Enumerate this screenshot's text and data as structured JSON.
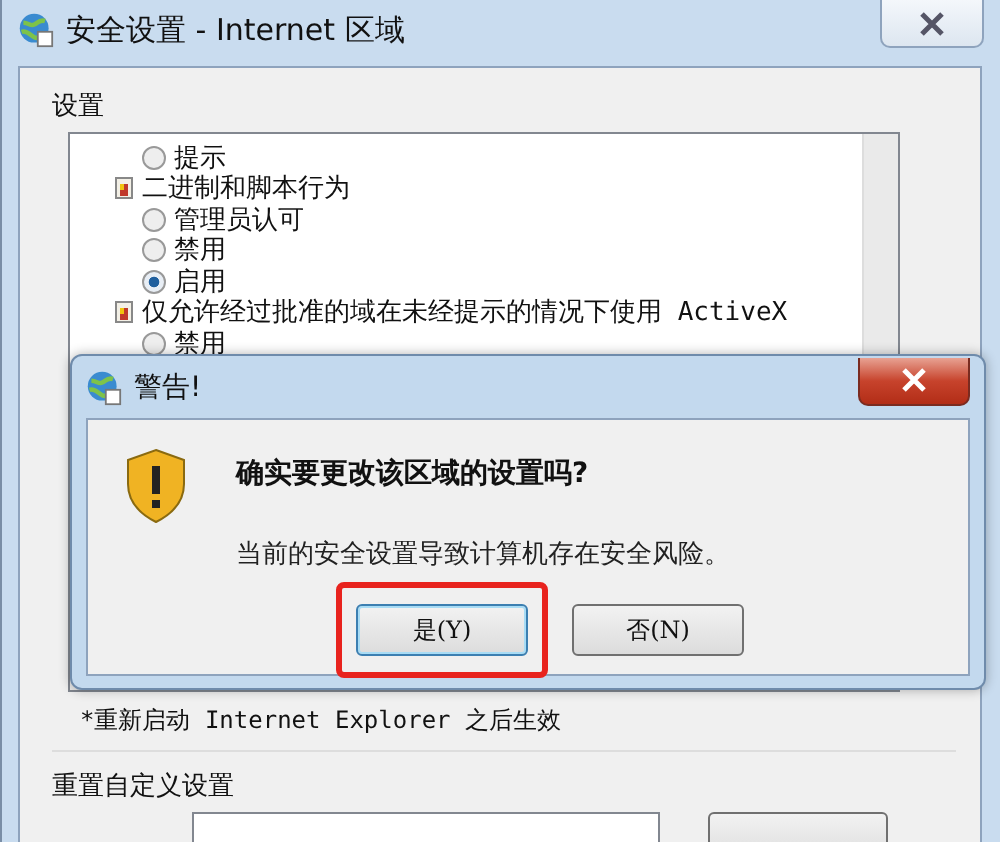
{
  "window": {
    "title": "安全设置 - Internet 区域"
  },
  "settings": {
    "label": "设置",
    "items": [
      {
        "kind": "radio",
        "label": "提示",
        "selected": false
      },
      {
        "kind": "heading",
        "label": "二进制和脚本行为"
      },
      {
        "kind": "radio",
        "label": "管理员认可",
        "selected": false
      },
      {
        "kind": "radio",
        "label": "禁用",
        "selected": false
      },
      {
        "kind": "radio",
        "label": "启用",
        "selected": true
      },
      {
        "kind": "heading",
        "label": "仅允许经过批准的域在未经提示的情况下使用 ActiveX"
      },
      {
        "kind": "radio",
        "label": "禁用",
        "selected": false
      }
    ],
    "note": "*重新启动 Internet Explorer 之后生效"
  },
  "reset": {
    "label": "重置自定义设置"
  },
  "dialog": {
    "title": "警告!",
    "heading": "确实要更改该区域的设置吗?",
    "message": "当前的安全设置导致计算机存在安全风险。",
    "buttons": [
      {
        "label": "是(Y)",
        "highlighted": true
      },
      {
        "label": "否(N)",
        "highlighted": false
      }
    ]
  }
}
